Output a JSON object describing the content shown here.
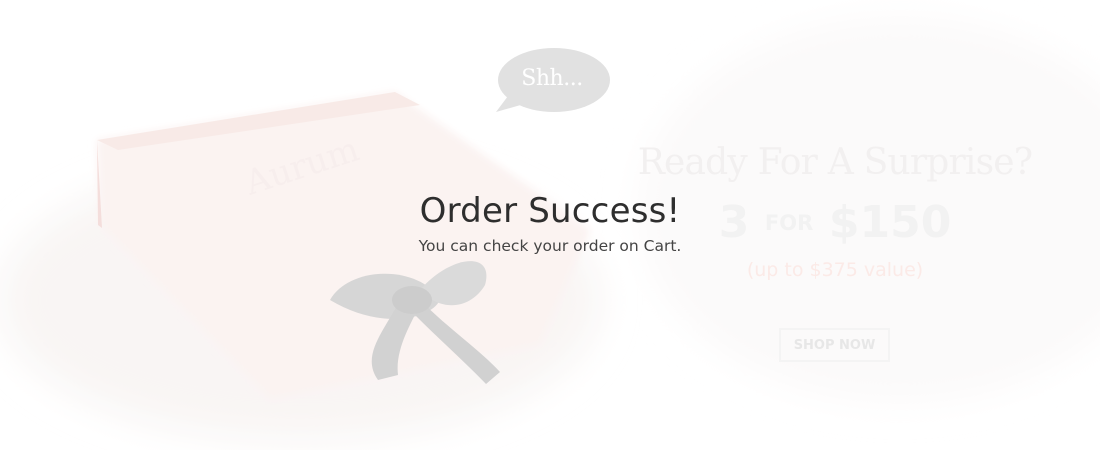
{
  "banner": {
    "bubble_text": "Shh...",
    "headline": "Ready For A Surprise?",
    "offer_quantity": "3",
    "offer_connector": "FOR",
    "offer_price": "$150",
    "offer_note": "(up to $375 value)",
    "shop_button_label": "SHOP NOW"
  },
  "notification": {
    "title": "Order Success!",
    "message": "You can check your order on Cart."
  },
  "colors": {
    "text_dark": "#2e2e2e",
    "text_muted": "#444444",
    "faded_banner_text": "#f0eeee",
    "accent_pink": "#fbe7e3"
  }
}
